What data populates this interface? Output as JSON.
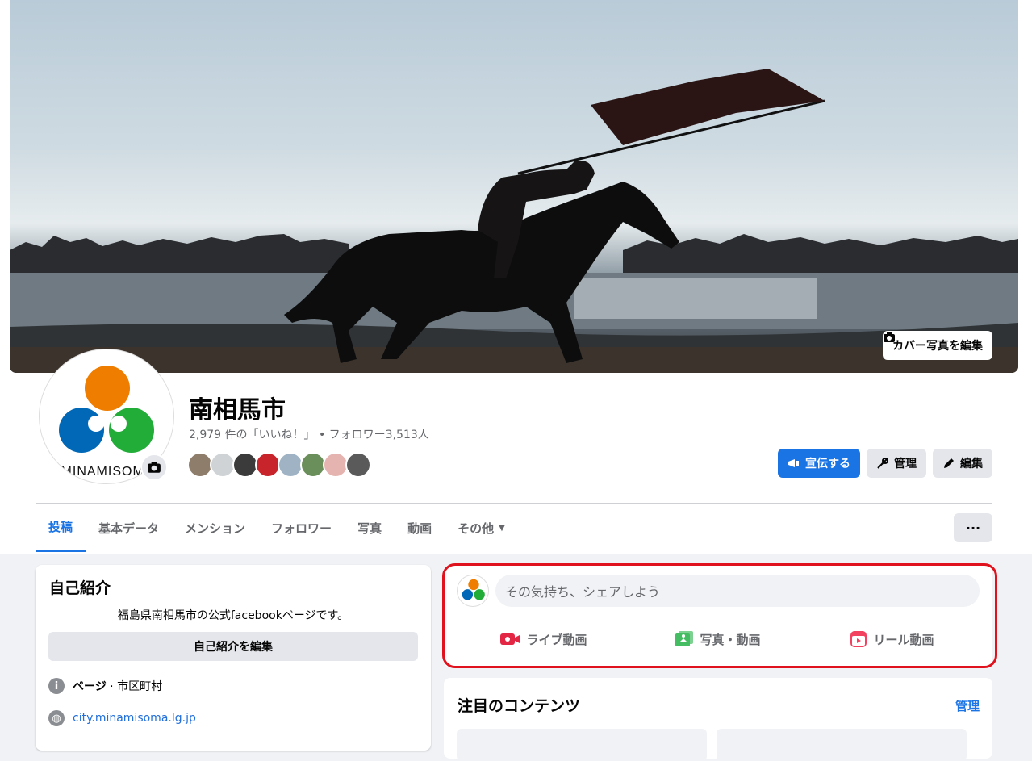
{
  "cover": {
    "edit_label": "カバー写真を編集"
  },
  "profile": {
    "name": "南相馬市",
    "stats": "2,979 件の「いいね！」 • フォロワー3,513人",
    "logo_text": "MINAMISOMA",
    "friend_colors": [
      "#8f7d6b",
      "#cfd3d6",
      "#3b3b3b",
      "#c8242b",
      "#9fb3c4",
      "#6b8f5a",
      "#e5b4b0",
      "#5a5a5a"
    ]
  },
  "actions": {
    "promote": "宣伝する",
    "manage": "管理",
    "edit": "編集"
  },
  "tabs": [
    {
      "label": "投稿"
    },
    {
      "label": "基本データ"
    },
    {
      "label": "メンション"
    },
    {
      "label": "フォロワー"
    },
    {
      "label": "写真"
    },
    {
      "label": "動画"
    },
    {
      "label": "その他"
    }
  ],
  "more_label": "···",
  "intro": {
    "title": "自己紹介",
    "description": "福島県南相馬市の公式facebookページです。",
    "edit_label": "自己紹介を編集",
    "category_prefix": "ページ",
    "category": "市区町村",
    "website": "city.minamisoma.lg.jp"
  },
  "composer": {
    "placeholder": "その気持ち、シェアしよう",
    "live_label": "ライブ動画",
    "photo_label": "写真・動画",
    "reel_label": "リール動画"
  },
  "featured": {
    "title": "注目のコンテンツ",
    "manage_label": "管理"
  },
  "colors": {
    "accent": "#1b74e4",
    "highlight": "#e0121d",
    "logo_orange": "#ee7d00",
    "logo_blue": "#0068b7",
    "logo_green": "#22ac38"
  }
}
